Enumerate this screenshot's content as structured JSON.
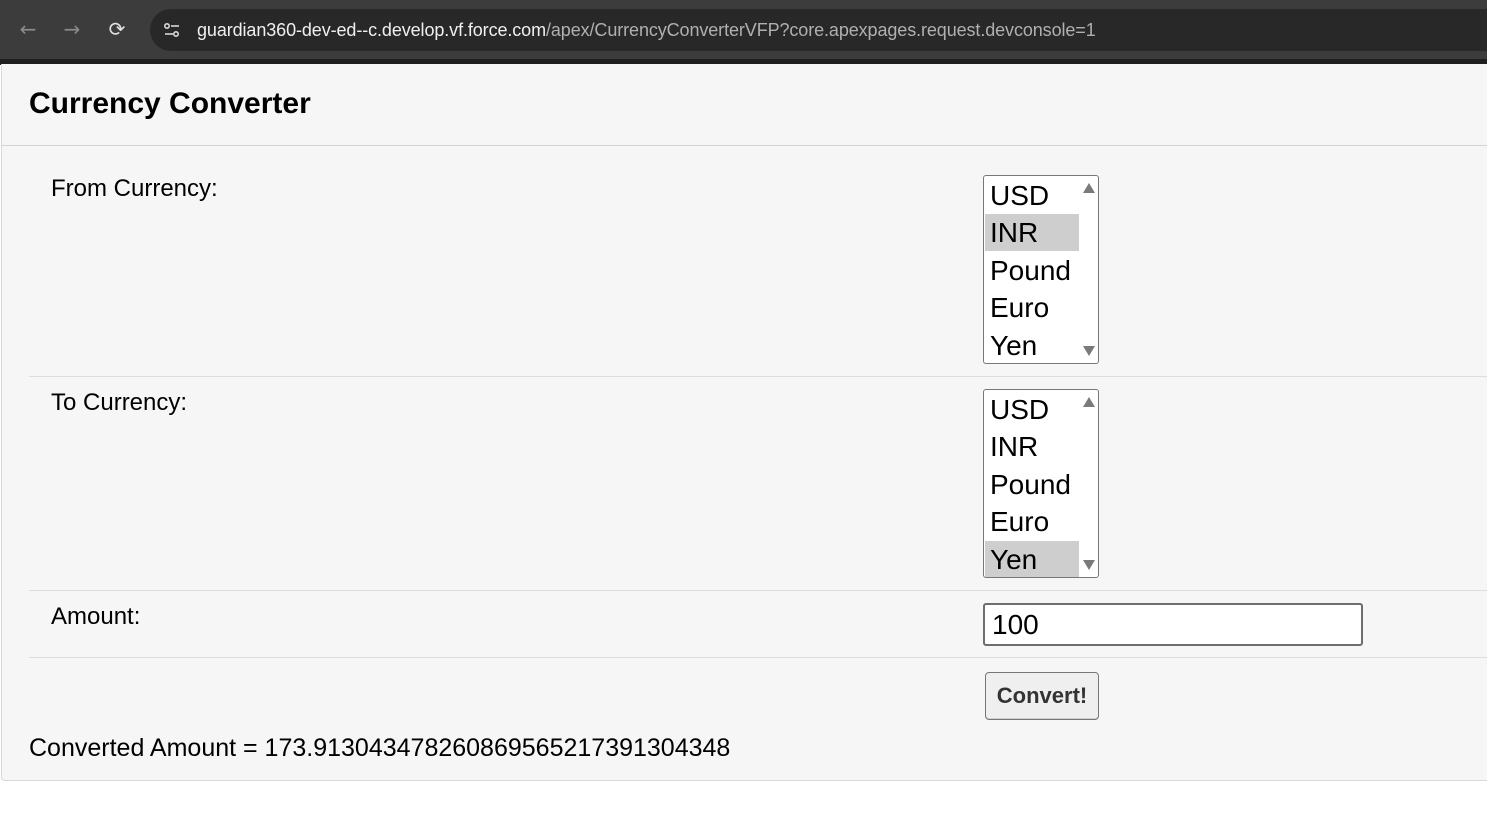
{
  "browser": {
    "url_host": "guardian360-dev-ed--c.develop.vf.force.com",
    "url_path": "/apex/CurrencyConverterVFP?core.apexpages.request.devconsole=1"
  },
  "page": {
    "title": "Currency Converter",
    "from_label": "From Currency:",
    "to_label": "To Currency:",
    "amount_label": "Amount:",
    "from_options": [
      "USD",
      "INR",
      "Pound",
      "Euro",
      "Yen"
    ],
    "from_selected": "INR",
    "to_options": [
      "USD",
      "INR",
      "Pound",
      "Euro",
      "Yen"
    ],
    "to_selected": "Yen",
    "amount_value": "100",
    "convert_label": "Convert!",
    "result_text": "Converted Amount = 173.91304347826086956521739130434‌8"
  },
  "icons": {
    "back": "arrow-left-icon",
    "forward": "arrow-right-icon",
    "reload": "reload-icon",
    "site_info": "site-settings-icon"
  }
}
